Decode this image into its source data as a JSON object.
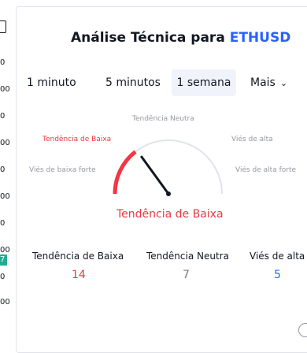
{
  "left_strip": {
    "values": [
      "0",
      "00",
      "0",
      "00",
      "0",
      "00",
      "0",
      "00",
      "0",
      "00"
    ],
    "badge": "7"
  },
  "header": {
    "title_prefix": "Análise Técnica para",
    "symbol": "ETHUSD"
  },
  "tabs": [
    {
      "label": "1 minuto"
    },
    {
      "label": "5 minutos"
    },
    {
      "label": "1 semana"
    },
    {
      "label": "Mais"
    }
  ],
  "gauge": {
    "labels": {
      "neutral": "Tendência Neutra",
      "sell": "Tendência de Baixa",
      "buy": "Viés de alta",
      "strong_sell": "Viés de baixa forte",
      "strong_buy": "Viés de alta forte"
    },
    "value": 0.18,
    "verdict": "Tendência de Baixa"
  },
  "summary": [
    {
      "label": "Tendência de Baixa",
      "value": "14"
    },
    {
      "label": "Tendência Neutra",
      "value": "7"
    },
    {
      "label": "Viés de alta",
      "value": "5"
    }
  ],
  "colors": {
    "sell": "#f23645",
    "neutral": "#787b86",
    "buy": "#2962ff",
    "accent": "#2962ff",
    "badge": "#22ab94"
  }
}
